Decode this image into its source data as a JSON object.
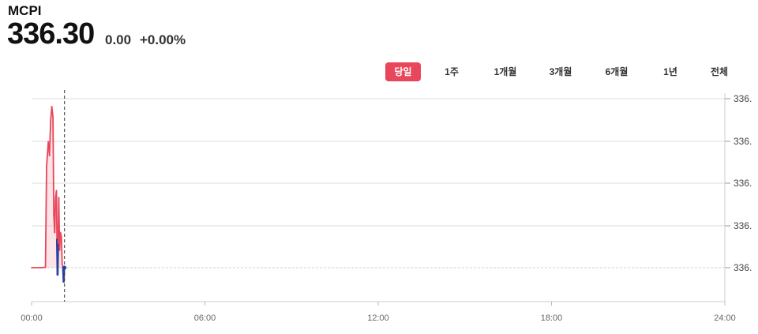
{
  "header": {
    "title": "MCPI",
    "price": "336.30",
    "change": "0.00",
    "change_pct": "+0.00%"
  },
  "tabs": [
    {
      "label": "당일",
      "active": true
    },
    {
      "label": "1주",
      "active": false
    },
    {
      "label": "1개월",
      "active": false
    },
    {
      "label": "3개월",
      "active": false
    },
    {
      "label": "6개월",
      "active": false
    },
    {
      "label": "1년",
      "active": false
    },
    {
      "label": "전체",
      "active": false
    }
  ],
  "colors": {
    "up": "#e8465a",
    "down": "#2b3f9c",
    "active_tab": "#e8465a",
    "grid": "#dddddd"
  },
  "chart_data": {
    "type": "line",
    "title": "",
    "xlabel": "",
    "ylabel": "",
    "x_ticks": [
      "00:00",
      "06:00",
      "12:00",
      "18:00",
      "24:00"
    ],
    "y_ticks": [
      "336.",
      "336.",
      "336.",
      "336.",
      "336."
    ],
    "baseline": 336.3,
    "series": [
      {
        "values_relative": [
          {
            "t": 0.0,
            "v": 0
          },
          {
            "t": 0.3,
            "v": 0
          },
          {
            "t": 0.48,
            "v": 0.01
          },
          {
            "t": 0.52,
            "v": 2.9
          },
          {
            "t": 0.58,
            "v": 3.6
          },
          {
            "t": 0.62,
            "v": 3.2
          },
          {
            "t": 0.66,
            "v": 4.2
          },
          {
            "t": 0.7,
            "v": 4.6
          },
          {
            "t": 0.74,
            "v": 4.3
          },
          {
            "t": 0.77,
            "v": 1.5
          },
          {
            "t": 0.8,
            "v": 1.0
          },
          {
            "t": 0.83,
            "v": 2.0
          },
          {
            "t": 0.86,
            "v": 2.2
          },
          {
            "t": 0.88,
            "v": 0.8
          },
          {
            "t": 0.9,
            "v": -0.2
          },
          {
            "t": 0.92,
            "v": 0.7
          },
          {
            "t": 0.94,
            "v": 2.0
          },
          {
            "t": 0.97,
            "v": 0.5
          },
          {
            "t": 1.0,
            "v": 1.0
          },
          {
            "t": 1.03,
            "v": 0.9
          },
          {
            "t": 1.06,
            "v": 0.1
          },
          {
            "t": 1.09,
            "v": 0.0
          },
          {
            "t": 1.11,
            "v": -0.4
          },
          {
            "t": 1.13,
            "v": 0.0
          }
        ]
      }
    ],
    "current_time_marker": 1.14,
    "grid": true
  }
}
